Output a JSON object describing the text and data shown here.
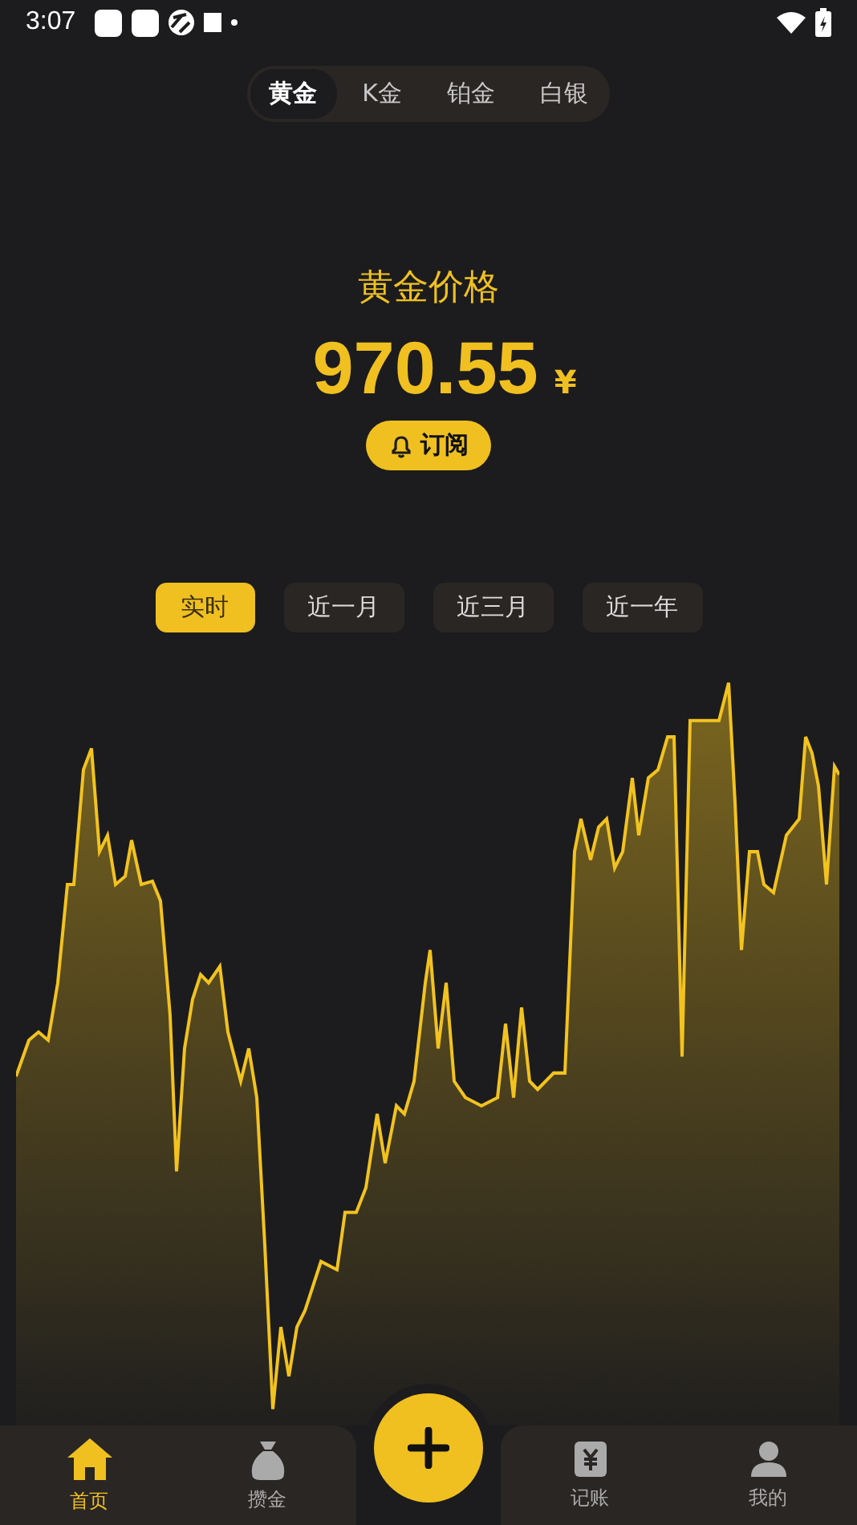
{
  "status_bar": {
    "time": "3:07"
  },
  "metal_tabs": [
    {
      "label": "黄金",
      "selected": true
    },
    {
      "label": "K金",
      "selected": false
    },
    {
      "label": "铂金",
      "selected": false
    },
    {
      "label": "白银",
      "selected": false
    }
  ],
  "price": {
    "title": "黄金价格",
    "value": "970.55",
    "currency": "¥"
  },
  "subscribe_button": {
    "label": "订阅"
  },
  "range_tabs": [
    {
      "label": "实时",
      "selected": true
    },
    {
      "label": "近一月",
      "selected": false
    },
    {
      "label": "近三月",
      "selected": false
    },
    {
      "label": "近一年",
      "selected": false
    }
  ],
  "bottom_nav": [
    {
      "label": "首页",
      "kind": "home",
      "selected": true
    },
    {
      "label": "攒金",
      "kind": "bag",
      "selected": false
    },
    {
      "label": "记账",
      "kind": "ledger",
      "selected": false
    },
    {
      "label": "我的",
      "kind": "profile",
      "selected": false
    }
  ]
}
